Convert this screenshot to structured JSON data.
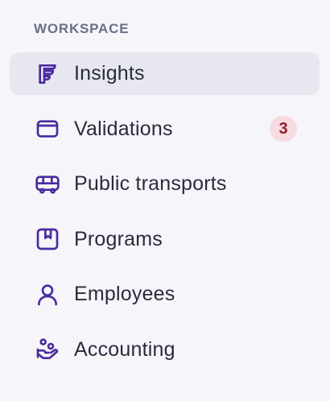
{
  "sidebar": {
    "section_title": "WORKSPACE",
    "items": [
      {
        "label": "Insights",
        "icon": "insights-icon",
        "active": true
      },
      {
        "label": "Validations",
        "icon": "card-icon",
        "badge": "3"
      },
      {
        "label": "Public transports",
        "icon": "bus-icon"
      },
      {
        "label": "Programs",
        "icon": "bookmark-book-icon"
      },
      {
        "label": "Employees",
        "icon": "user-icon"
      },
      {
        "label": "Accounting",
        "icon": "hand-coins-icon"
      }
    ]
  },
  "colors": {
    "background": "#f5f5fa",
    "active_background": "#e7e7ef",
    "icon": "#4b2a9f",
    "text": "#2a2c3d",
    "section_title": "#6b6f85",
    "badge_bg": "#f6dbe0",
    "badge_text": "#8f1d2e"
  }
}
